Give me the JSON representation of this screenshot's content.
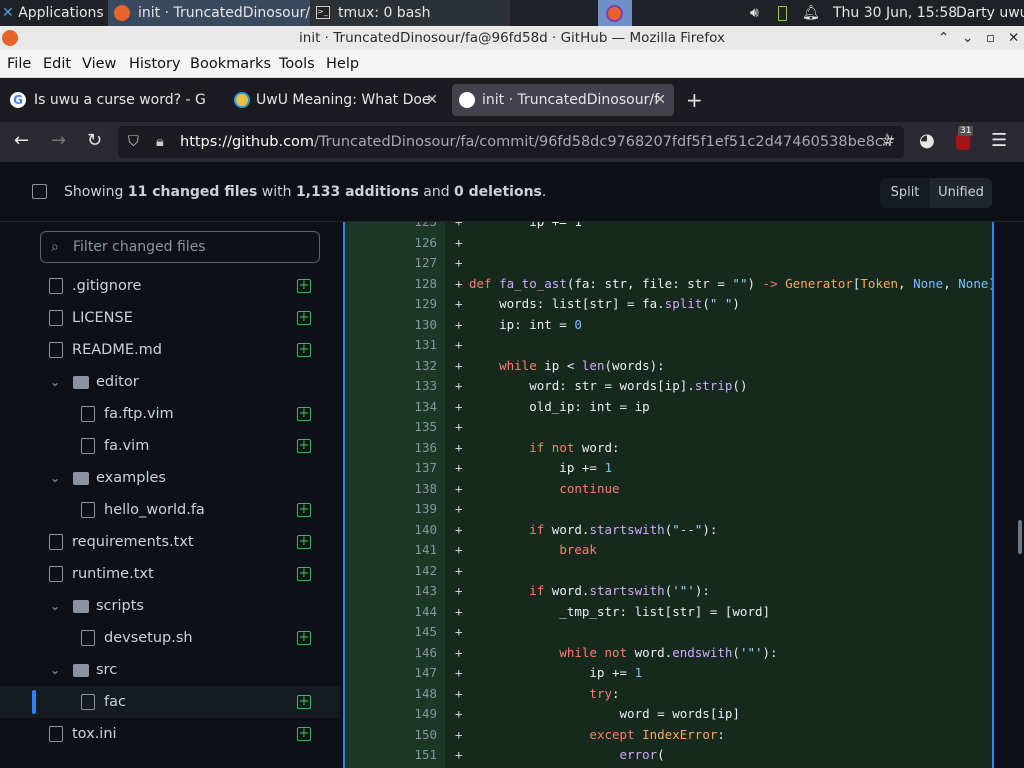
{
  "taskbar": {
    "applications": "Applications",
    "window1": "init · TruncatedDinosour/...",
    "window2": "tmux: 0 bash",
    "clock": "Thu 30 Jun, 15:58",
    "user": "Darty uwu"
  },
  "browser": {
    "title": "init · TruncatedDinosour/fa@96fd58d · GitHub — Mozilla Firefox",
    "menu": [
      "File",
      "Edit",
      "View",
      "History",
      "Bookmarks",
      "Tools",
      "Help"
    ],
    "tabs": [
      {
        "label": "Is uwu a curse word? - G"
      },
      {
        "label": "UwU Meaning: What Doe"
      },
      {
        "label": "init · TruncatedDinosour/f"
      }
    ],
    "url_host": "https://github.com",
    "url_path": "/TruncatedDinosour/fa/commit/96fd58dc9768207fdf5f1ef51c2d47460538be8c#",
    "extension_badge": "31"
  },
  "summary": {
    "prefix": "Showing ",
    "files": "11 changed files",
    "mid": " with ",
    "additions": "1,133 additions",
    "and": " and ",
    "deletions": "0 deletions",
    "end": "."
  },
  "view_toggle": {
    "split": "Split",
    "unified": "Unified"
  },
  "filter": {
    "placeholder": "Filter changed files"
  },
  "tree": [
    {
      "label": ".gitignore",
      "type": "file",
      "depth": 0
    },
    {
      "label": "LICENSE",
      "type": "file",
      "depth": 0
    },
    {
      "label": "README.md",
      "type": "file",
      "depth": 0
    },
    {
      "label": "editor",
      "type": "folder",
      "depth": 0
    },
    {
      "label": "fa.ftp.vim",
      "type": "file",
      "depth": 1
    },
    {
      "label": "fa.vim",
      "type": "file",
      "depth": 1
    },
    {
      "label": "examples",
      "type": "folder",
      "depth": 0
    },
    {
      "label": "hello_world.fa",
      "type": "file",
      "depth": 1
    },
    {
      "label": "requirements.txt",
      "type": "file",
      "depth": 0
    },
    {
      "label": "runtime.txt",
      "type": "file",
      "depth": 0
    },
    {
      "label": "scripts",
      "type": "folder",
      "depth": 0
    },
    {
      "label": "devsetup.sh",
      "type": "file",
      "depth": 1
    },
    {
      "label": "src",
      "type": "folder",
      "depth": 0
    },
    {
      "label": "fac",
      "type": "file",
      "depth": 1,
      "selected": true
    },
    {
      "label": "tox.ini",
      "type": "file",
      "depth": 0
    }
  ],
  "diff": [
    {
      "n": "125",
      "code": [
        [
          "",
          "        ip += 1"
        ]
      ]
    },
    {
      "n": "126",
      "code": []
    },
    {
      "n": "127",
      "code": []
    },
    {
      "n": "128",
      "code": [
        [
          "kw",
          "def "
        ],
        [
          "fn",
          "fa_to_ast"
        ],
        [
          "",
          "(fa: str, file: str = "
        ],
        [
          "st",
          "\"\""
        ],
        [
          "",
          ") "
        ],
        [
          "kw",
          "->"
        ],
        [
          "",
          " "
        ],
        [
          "ty",
          "Generator"
        ],
        [
          "",
          "["
        ],
        [
          "ty",
          "Token"
        ],
        [
          "",
          ", "
        ],
        [
          "cn",
          "None"
        ],
        [
          "",
          ", "
        ],
        [
          "cn",
          "None"
        ],
        [
          "",
          "]:"
        ]
      ]
    },
    {
      "n": "129",
      "code": [
        [
          "",
          "    words: list[str] = fa."
        ],
        [
          "fn",
          "split"
        ],
        [
          "",
          "("
        ],
        [
          "st",
          "\" \""
        ],
        [
          "",
          ")"
        ]
      ]
    },
    {
      "n": "130",
      "code": [
        [
          "",
          "    ip: int = "
        ],
        [
          "cn",
          "0"
        ]
      ]
    },
    {
      "n": "131",
      "code": []
    },
    {
      "n": "132",
      "code": [
        [
          "",
          "    "
        ],
        [
          "kw",
          "while"
        ],
        [
          "",
          " ip < "
        ],
        [
          "fn",
          "len"
        ],
        [
          "",
          "(words):"
        ]
      ]
    },
    {
      "n": "133",
      "code": [
        [
          "",
          "        word: str = words[ip]."
        ],
        [
          "fn",
          "strip"
        ],
        [
          "",
          "()"
        ]
      ]
    },
    {
      "n": "134",
      "code": [
        [
          "",
          "        old_ip: int = ip"
        ]
      ]
    },
    {
      "n": "135",
      "code": []
    },
    {
      "n": "136",
      "code": [
        [
          "",
          "        "
        ],
        [
          "kw",
          "if not"
        ],
        [
          "",
          " word:"
        ]
      ]
    },
    {
      "n": "137",
      "code": [
        [
          "",
          "            ip += "
        ],
        [
          "cn",
          "1"
        ]
      ]
    },
    {
      "n": "138",
      "code": [
        [
          "",
          "            "
        ],
        [
          "kw",
          "continue"
        ]
      ]
    },
    {
      "n": "139",
      "code": []
    },
    {
      "n": "140",
      "code": [
        [
          "",
          "        "
        ],
        [
          "kw",
          "if"
        ],
        [
          "",
          " word."
        ],
        [
          "fn",
          "startswith"
        ],
        [
          "",
          "("
        ],
        [
          "st",
          "\"--\""
        ],
        [
          "",
          "):"
        ]
      ]
    },
    {
      "n": "141",
      "code": [
        [
          "",
          "            "
        ],
        [
          "kw",
          "break"
        ]
      ]
    },
    {
      "n": "142",
      "code": []
    },
    {
      "n": "143",
      "code": [
        [
          "",
          "        "
        ],
        [
          "kw",
          "if"
        ],
        [
          "",
          " word."
        ],
        [
          "fn",
          "startswith"
        ],
        [
          "",
          "("
        ],
        [
          "st",
          "'\"'"
        ],
        [
          "",
          "):"
        ]
      ]
    },
    {
      "n": "144",
      "code": [
        [
          "",
          "            _tmp_str: list[str] = [word]"
        ]
      ]
    },
    {
      "n": "145",
      "code": []
    },
    {
      "n": "146",
      "code": [
        [
          "",
          "            "
        ],
        [
          "kw",
          "while not"
        ],
        [
          "",
          " word."
        ],
        [
          "fn",
          "endswith"
        ],
        [
          "",
          "("
        ],
        [
          "st",
          "'\"'"
        ],
        [
          "",
          "):"
        ]
      ]
    },
    {
      "n": "147",
      "code": [
        [
          "",
          "                ip += "
        ],
        [
          "cn",
          "1"
        ]
      ]
    },
    {
      "n": "148",
      "code": [
        [
          "",
          "                "
        ],
        [
          "kw",
          "try"
        ],
        [
          "",
          ":"
        ]
      ]
    },
    {
      "n": "149",
      "code": [
        [
          "",
          "                    word = words[ip]"
        ]
      ]
    },
    {
      "n": "150",
      "code": [
        [
          "",
          "                "
        ],
        [
          "kw",
          "except"
        ],
        [
          "",
          " "
        ],
        [
          "ty",
          "IndexError"
        ],
        [
          "",
          ":"
        ]
      ]
    },
    {
      "n": "151",
      "code": [
        [
          "",
          "                    "
        ],
        [
          "fn",
          "error"
        ],
        [
          "",
          "("
        ]
      ]
    }
  ]
}
